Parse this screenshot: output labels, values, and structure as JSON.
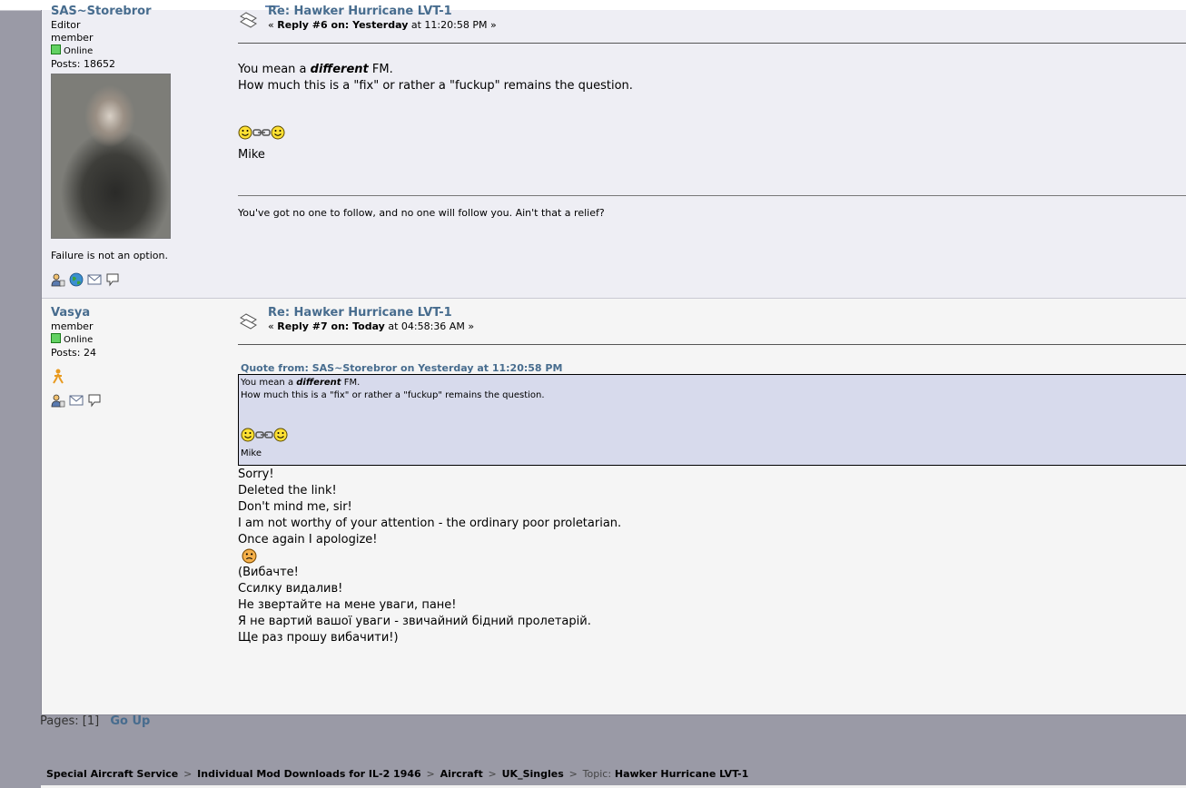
{
  "post1": {
    "poster": {
      "name": "SAS~Storebror",
      "title": "Editor",
      "group": "member",
      "status": "Online",
      "posts": "Posts: 18652",
      "personal_text": "Failure is not an option."
    },
    "subject": "Re: Hawker Hurricane LVT-1",
    "reply_prefix": "« ",
    "reply_bold": "Reply #6 on: Yesterday",
    "reply_time": " at 11:20:58 PM »",
    "body_line1_pre": "You mean a ",
    "body_line1_em": "different",
    "body_line1_post": " FM.",
    "body_line2": "How much this is a \"fix\" or rather a \"fuckup\" remains the question.",
    "signoff": "Mike",
    "signature": "You've got no one to follow, and no one will follow you. Ain't that a relief?"
  },
  "post2": {
    "poster": {
      "name": "Vasya",
      "group": "member",
      "status": "Online",
      "posts": "Posts: 24"
    },
    "subject": "Re: Hawker Hurricane LVT-1",
    "reply_prefix": "« ",
    "reply_bold": "Reply #7 on: Today",
    "reply_time": " at 04:58:36 AM »",
    "quote_header": "Quote from: SAS~Storebror on Yesterday at 11:20:58 PM",
    "quote_line1_pre": "You mean a ",
    "quote_line1_em": "different",
    "quote_line1_post": " FM.",
    "quote_line2": "How much this is a \"fix\" or rather a \"fuckup\" remains the question.",
    "quote_signoff": "Mike",
    "lines_en": [
      "Sorry!",
      "Deleted the link!",
      "Don't mind me, sir!",
      "I am not worthy of your attention - the ordinary poor proletarian.",
      "Once again I apologize!"
    ],
    "lines_uk": [
      "(Вибачте!",
      "Ссилку видалив!",
      "Не звертайте на мене уваги, пане!",
      "Я не вартий вашої уваги - звичайний бідний пролетарій.",
      "Ще раз прошу вибачити!)"
    ]
  },
  "pages": {
    "label": "Pages: [1]",
    "go_up": "Go Up"
  },
  "breadcrumb": {
    "items": [
      "Special Aircraft Service",
      "Individual Mod Downloads for IL-2 1946",
      "Aircraft",
      "UK_Singles"
    ],
    "separator": ">",
    "topic_label": "Topic:",
    "topic": "Hawker Hurricane LVT-1"
  },
  "colors": {
    "link": "#476c8e",
    "post_alt_bg": "#eeeef4",
    "post_bg": "#f5f5f5",
    "quote_bg": "#d7daec",
    "page_bg": "#9a9aa6"
  }
}
